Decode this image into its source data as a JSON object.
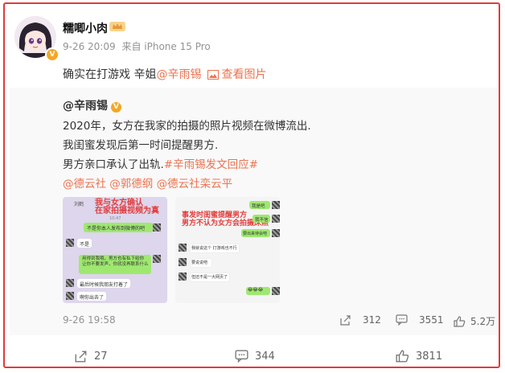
{
  "post": {
    "username": "糯唧小肉",
    "time": "9-26 20:09",
    "source": "来自 iPhone 15 Pro",
    "text_plain": "确实在打游戏 辛姐",
    "mention": "@辛雨锡",
    "view_images_label": "查看图片"
  },
  "repost": {
    "author": "@辛雨锡",
    "line1": "2020年，女方在我家的拍摄的照片视频在微博流出.",
    "line2": "我闺蜜发现后第一时间提醒男方.",
    "line3_plain": "男方亲口承认了出轨.",
    "line3_tag": "#辛雨锡发文回应#",
    "mentions": [
      "@德云社",
      "@郭德纲",
      "@德云社栾云平"
    ],
    "image1": {
      "overlay_title": "我与女方确认\n在家拍摄视频为真",
      "chat_time": "10:47",
      "name_label": "刘鹤",
      "messages": [
        "不是你本人发布到微博的吧",
        "不是",
        "用得到我哦，男方也有私下给你\n让你不要发声，你就没再联系什么",
        "最后时候我朋友打着了",
        "啊你出去了"
      ]
    },
    "image2": {
      "overlay_title": "事发时闺蜜提醒男方\n男方不认为女方会拍摄床照",
      "messages": [
        "我是吧",
        "我不信",
        "要出来待会吧",
        "我就说这个 打游戏也不行",
        "要说说吧",
        "但还不是一大网页了",
        "😂😂😂"
      ]
    },
    "time": "9-26 19:58",
    "repost_count": "312",
    "comment_count": "3551",
    "like_count": "5.2万"
  },
  "actions": {
    "repost_count": "27",
    "comment_count": "344",
    "like_count": "3811"
  },
  "colors": {
    "link": "#eb7350",
    "highlight_border": "#e13b3b",
    "overlay_text": "#e23c3c",
    "chat_bubble_green": "#9fe870"
  }
}
